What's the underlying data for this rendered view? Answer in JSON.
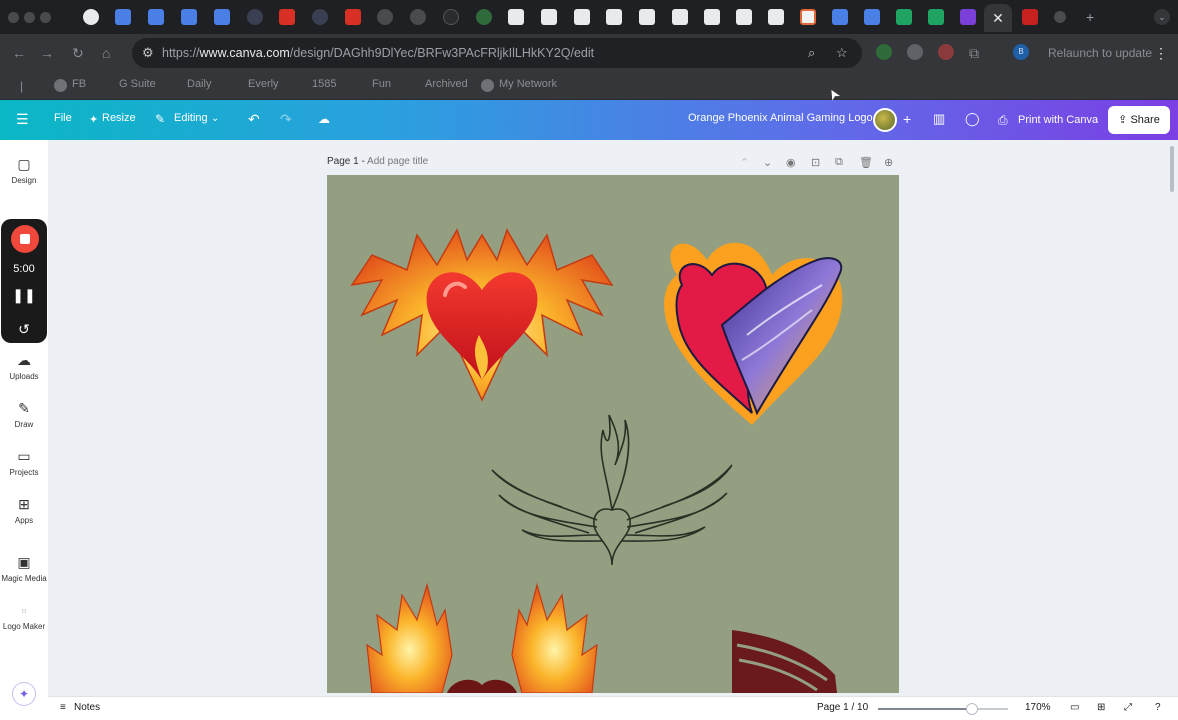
{
  "browser": {
    "url_prefix": "https://",
    "url_host": "www.canva.com",
    "url_path": "/design/DAGhh9DlYec/BRFw3PAcFRljkIlLHkKY2Q/edit",
    "relaunch_label": "Relaunch to update",
    "active_tab_close": "✕",
    "new_tab": "+",
    "profile_initial": "B"
  },
  "bookmarks": [
    {
      "label": "FB"
    },
    {
      "label": "G Suite"
    },
    {
      "label": "Daily"
    },
    {
      "label": "Everly"
    },
    {
      "label": "1585"
    },
    {
      "label": "Fun"
    },
    {
      "label": "Archived"
    },
    {
      "label": "My Network"
    }
  ],
  "editor": {
    "file_label": "File",
    "resize_label": "Resize",
    "editing_label": "Editing",
    "design_title": "Orange Phoenix Animal Gaming Logo",
    "print_label": "Print with Canva",
    "share_label": "Share"
  },
  "rail": {
    "design": "Design",
    "uploads": "Uploads",
    "draw": "Draw",
    "projects": "Projects",
    "apps": "Apps",
    "magic_media": "Magic Media",
    "logo_maker": "Logo Maker"
  },
  "recorder": {
    "time": "5:00"
  },
  "page": {
    "label": "Page 1 -",
    "title_placeholder": "Add page title"
  },
  "bottom": {
    "notes_label": "Notes",
    "page_indicator": "Page 1 / 10",
    "zoom": "170%",
    "zoom_fraction": 0.72
  },
  "colors": {
    "canvas_bg": "#949f82",
    "header_start": "#0ab7c5",
    "header_end": "#7b3fe4",
    "record_red": "#f0493b"
  }
}
